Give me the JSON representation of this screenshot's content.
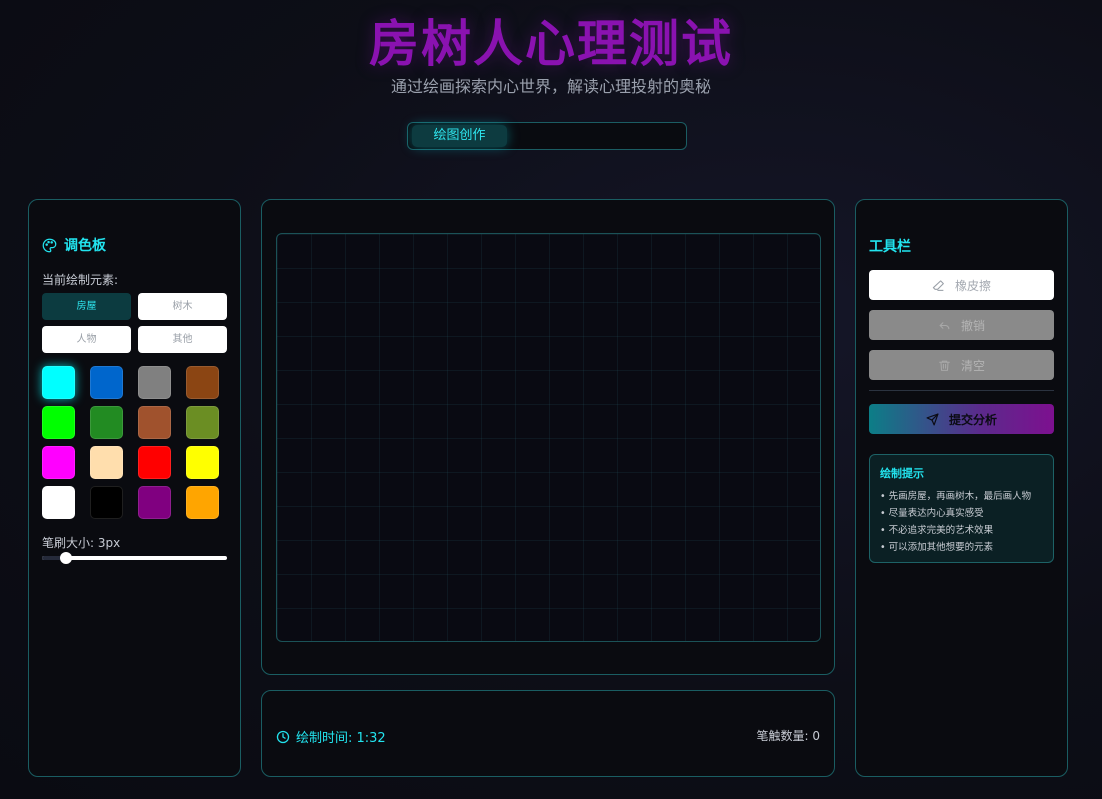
{
  "header": {
    "title": "房树人心理测试",
    "subtitle": "通过绘画探索内心世界，解读心理投射的奥秘"
  },
  "tabs": [
    {
      "label": "绘图创作",
      "active": true
    }
  ],
  "palette": {
    "title": "调色板",
    "icon": "palette-icon",
    "current_element_label": "当前绘制元素:",
    "elements": [
      {
        "label": "房屋",
        "active": true
      },
      {
        "label": "树木",
        "active": false
      },
      {
        "label": "人物",
        "active": false
      },
      {
        "label": "其他",
        "active": false
      }
    ],
    "colors": [
      {
        "hex": "#00ffff",
        "selected": true
      },
      {
        "hex": "#0066cc",
        "selected": false
      },
      {
        "hex": "#808080",
        "selected": false
      },
      {
        "hex": "#8b4513",
        "selected": false
      },
      {
        "hex": "#00ff00",
        "selected": false
      },
      {
        "hex": "#228b22",
        "selected": false
      },
      {
        "hex": "#a0522d",
        "selected": false
      },
      {
        "hex": "#6b8e23",
        "selected": false
      },
      {
        "hex": "#ff00ff",
        "selected": false
      },
      {
        "hex": "#ffdead",
        "selected": false
      },
      {
        "hex": "#ff0000",
        "selected": false
      },
      {
        "hex": "#ffff00",
        "selected": false
      },
      {
        "hex": "#ffffff",
        "selected": false
      },
      {
        "hex": "#000000",
        "selected": false
      },
      {
        "hex": "#800080",
        "selected": false
      },
      {
        "hex": "#ffa500",
        "selected": false
      }
    ],
    "brush_label": "笔刷大小: 3px",
    "brush_size_fraction": 0.13
  },
  "status": {
    "time_label": "绘制时间: 1:32",
    "time_icon": "clock-icon",
    "strokes_label": "笔触数量: 0"
  },
  "toolbar": {
    "title": "工具栏",
    "eraser_label": "橡皮擦",
    "eraser_icon": "eraser-icon",
    "undo_label": "撤销",
    "undo_icon": "undo-icon",
    "clear_label": "清空",
    "clear_icon": "trash-icon",
    "submit_label": "提交分析",
    "submit_icon": "send-icon"
  },
  "tips": {
    "title": "绘制提示",
    "items": [
      "• 先画房屋，再画树木，最后画人物",
      "• 尽量表达内心真实感受",
      "• 不必追求完美的艺术效果",
      "• 可以添加其他想要的元素"
    ]
  },
  "colors": {
    "accent": "#22e3ee",
    "title": "#8a12b0",
    "panel_border": "#1a5d62"
  }
}
